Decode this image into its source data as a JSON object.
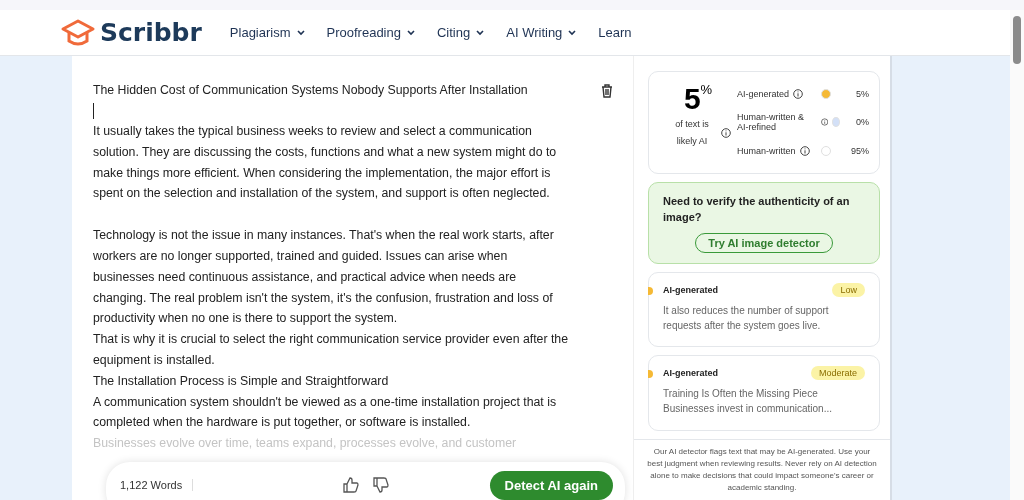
{
  "header": {
    "logo": "Scribbr",
    "nav": [
      {
        "label": "Plagiarism",
        "dropdown": true
      },
      {
        "label": "Proofreading",
        "dropdown": true
      },
      {
        "label": "Citing",
        "dropdown": true
      },
      {
        "label": "AI Writing",
        "dropdown": true
      },
      {
        "label": "Learn",
        "dropdown": false
      }
    ]
  },
  "editor": {
    "title": "The Hidden Cost of Communication Systems Nobody Supports After Installation",
    "sections": [
      {
        "paragraphs": [
          "It usually takes the typical business weeks to review and select a communication solution. They are discussing the costs, functions and what a new system might do to make things more efficient. When considering the implementation, the major effort is spent on the selection and installation of the system, and support is often neglected."
        ]
      },
      {
        "paragraphs": [
          "Technology is not the issue in many instances. That's when the real work starts, after workers are no longer supported, trained and guided. Issues can arise when businesses need continuous assistance, and practical advice when needs are changing. The real problem isn't the system, it's the confusion, frustration and loss of productivity when no one is there to support the system.",
          "That is why it is crucial to select the right communication service provider even after the equipment is installed.",
          "The Installation Process is Simple and Straightforward",
          "A communication system shouldn't be viewed as a one-time installation project that is completed when the hardware is put together, or software is installed."
        ]
      }
    ],
    "faded_text": "Businesses evolve over time, teams expand, processes evolve, and customer",
    "word_count": "1,122 Words",
    "detect_button": "Detect AI again"
  },
  "summary": {
    "percent": "5",
    "percent_sign": "%",
    "caption": "of text is likely AI",
    "categories": [
      {
        "label": "AI-generated",
        "color": "#f5b935",
        "value": "5%"
      },
      {
        "label": "Human-written & AI-refined",
        "color": "#d3e0f7",
        "value": "0%"
      },
      {
        "label": "Human-written",
        "color": "#ffffff",
        "value": "95%"
      }
    ]
  },
  "promo": {
    "text": "Need to verify the authenticity of an image?",
    "button": "Try AI image detector"
  },
  "results": [
    {
      "label": "AI-generated",
      "badge": "Low",
      "color": "#f5b935",
      "text": "It also reduces the number of support requests after the system goes live."
    },
    {
      "label": "AI-generated",
      "badge": "Moderate",
      "color": "#f5b935",
      "text": "Training Is Often the Missing Piece Businesses invest in communication..."
    }
  ],
  "disclaimer": "Our AI detector flags text that may be AI-generated. Use your best judgment when reviewing results. Never rely on AI detection alone to make decisions that could impact someone's career or academic standing."
}
